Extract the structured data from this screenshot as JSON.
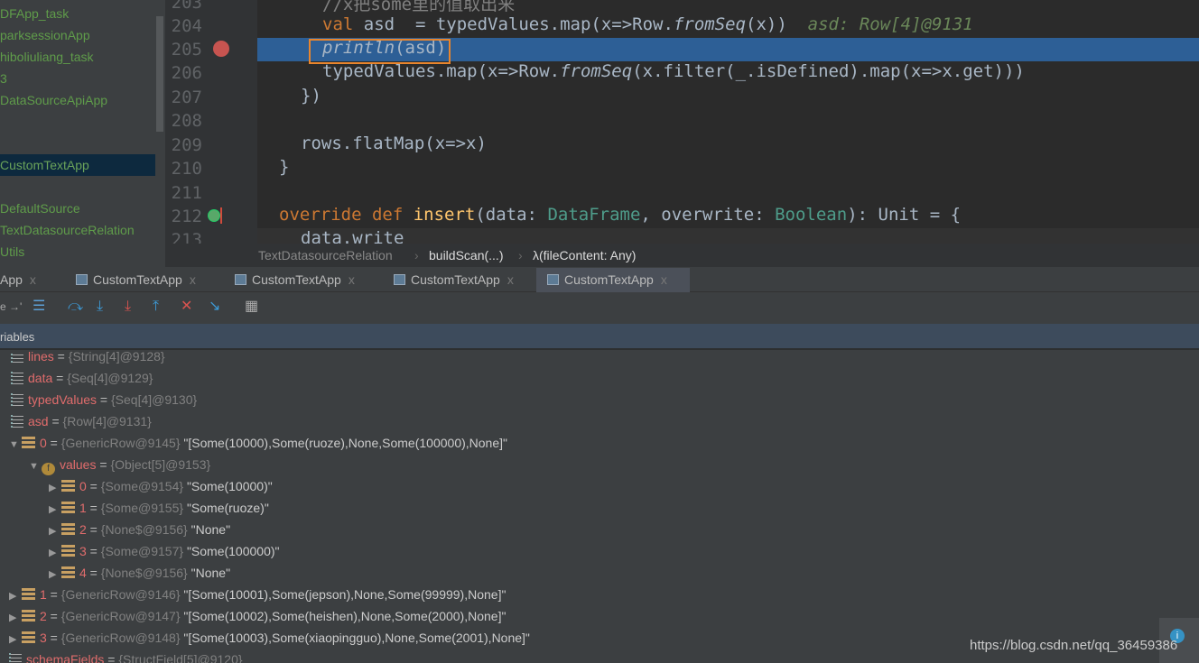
{
  "project_tree": [
    {
      "label": "DFApp_task"
    },
    {
      "label": "parksessionApp"
    },
    {
      "label": "hiboliuliang_task"
    },
    {
      "label": "3"
    },
    {
      "label": "DataSourceApiApp"
    },
    {
      "label": ""
    },
    {
      "label": ""
    },
    {
      "label": "CustomTextApp",
      "selected": true
    },
    {
      "label": ""
    },
    {
      "label": "DefaultSource"
    },
    {
      "label": "TextDatasourceRelation"
    },
    {
      "label": "Utils"
    }
  ],
  "editor": {
    "line_numbers": [
      "203",
      "204",
      "205",
      "206",
      "207",
      "208",
      "209",
      "210",
      "211",
      "212",
      "213"
    ],
    "lines": {
      "l203": "//x把some里的值取出来",
      "l204_code": " asd  = typedValues.map(x=>Row.",
      "l204_fn": "fromSeq",
      "l204_end": "(x))",
      "l204_hint": "asd: Row[4]@9131",
      "l205": "println",
      "l205_end": "(asd)",
      "l206a": "typedValues.map(x=>Row.",
      "l206_fn": "fromSeq",
      "l206_end": "(x.filter(_.isDefined).map(x=>x.get)))",
      "l207": "})",
      "l209": "rows.flatMap(x=>x)",
      "l210": "}",
      "l212_kw1": "override def ",
      "l212_fn": "insert",
      "l212_a": "(data: ",
      "l212_t1": "DataFrame",
      "l212_b": ", overwrite: ",
      "l212_t2": "Boolean",
      "l212_c": "): Unit = {",
      "l213": "data.write"
    },
    "kw_val": "val"
  },
  "breadcrumb": [
    "TextDatasourceRelation",
    "buildScan(...)",
    "λ(fileContent: Any)"
  ],
  "debug_tabs": [
    {
      "label": "App"
    },
    {
      "label": "CustomTextApp"
    },
    {
      "label": "CustomTextApp"
    },
    {
      "label": "CustomTextApp"
    },
    {
      "label": "CustomTextApp",
      "active": true
    }
  ],
  "close_glyph": "x",
  "toolbar": {
    "partial_label": "e →'"
  },
  "variables": {
    "header": "riables",
    "rows": [
      {
        "name": "lines",
        "type": "{String[4]@9128}",
        "value": ""
      },
      {
        "name": "data",
        "type": "{Seq[4]@9129}",
        "value": ""
      },
      {
        "name": "typedValues",
        "type": "{Seq[4]@9130}",
        "value": ""
      },
      {
        "name": "asd",
        "type": "{Row[4]@9131}",
        "value": ""
      },
      {
        "name": "0",
        "type": "{GenericRow@9145}",
        "value": "\"[Some(10000),Some(ruoze),None,Some(100000),None]\""
      },
      {
        "name": "values",
        "type": "{Object[5]@9153}",
        "value": ""
      },
      {
        "name": "0",
        "type": "{Some@9154}",
        "value": "\"Some(10000)\""
      },
      {
        "name": "1",
        "type": "{Some@9155}",
        "value": "\"Some(ruoze)\""
      },
      {
        "name": "2",
        "type": "{None$@9156}",
        "value": "\"None\""
      },
      {
        "name": "3",
        "type": "{Some@9157}",
        "value": "\"Some(100000)\""
      },
      {
        "name": "4",
        "type": "{None$@9156}",
        "value": "\"None\""
      },
      {
        "name": "1",
        "type": "{GenericRow@9146}",
        "value": "\"[Some(10001),Some(jepson),None,Some(99999),None]\""
      },
      {
        "name": "2",
        "type": "{GenericRow@9147}",
        "value": "\"[Some(10002),Some(heishen),None,Some(2000),None]\""
      },
      {
        "name": "3",
        "type": "{GenericRow@9148}",
        "value": "\"[Some(10003),Some(xiaopingguo),None,Some(2001),None]\""
      },
      {
        "name": "schemaFields",
        "type": "{StructField[5]@9120}",
        "value": ""
      }
    ]
  },
  "watermark": "https://blog.csdn.net/qq_36459386",
  "colors": {
    "accent_selection": "#2d5f96",
    "highlight_box": "#e8852d",
    "var_name": "#e06c6c"
  }
}
